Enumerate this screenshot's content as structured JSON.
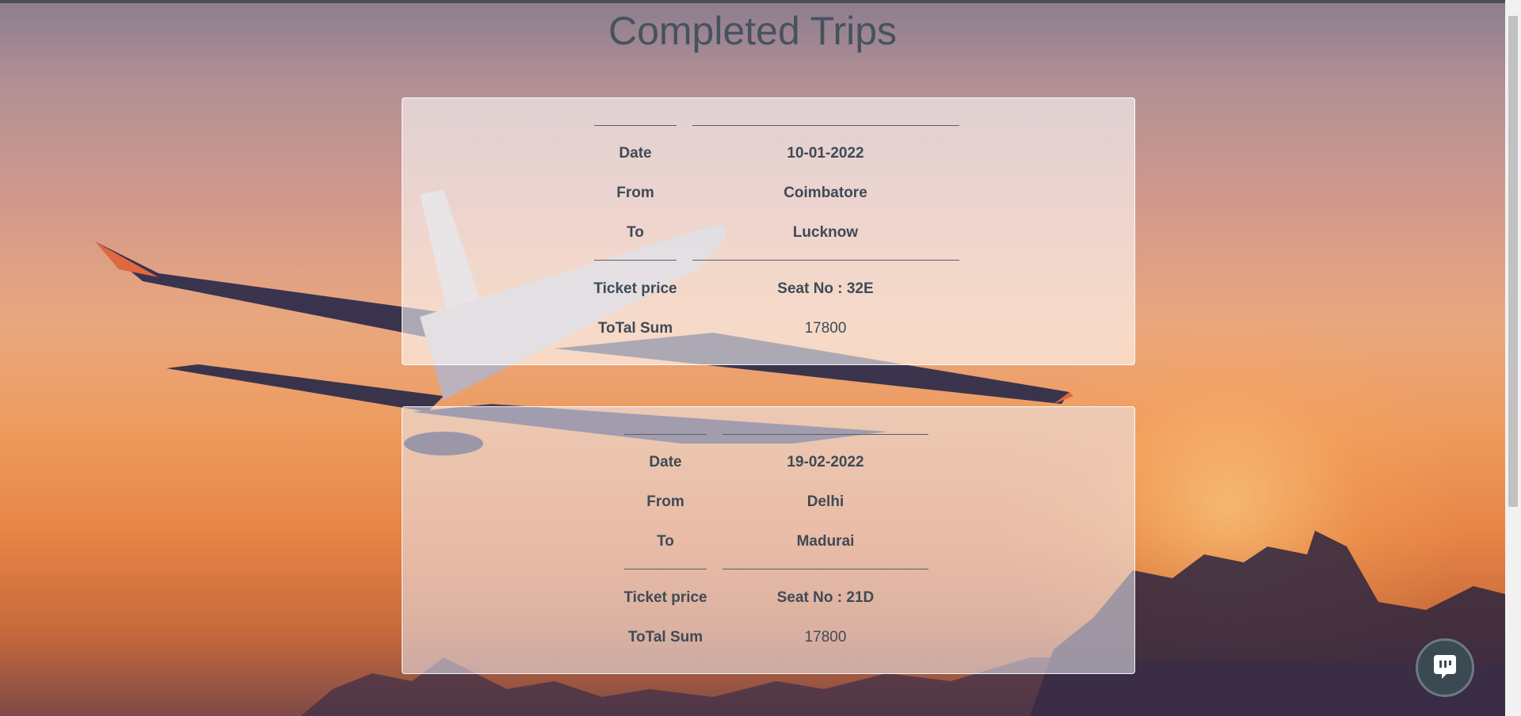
{
  "page": {
    "title": "Completed Trips"
  },
  "trips": [
    {
      "date_label": "Date",
      "date_value": "10-01-2022",
      "from_label": "From",
      "from_value": "Coimbatore",
      "to_label": "To",
      "to_value": "Lucknow",
      "price_label": "Ticket price",
      "seat_value": "Seat No : 32E",
      "total_label": "ToTal Sum",
      "total_value": "17800"
    },
    {
      "date_label": "Date",
      "date_value": "19-02-2022",
      "from_label": "From",
      "from_value": "Delhi",
      "to_label": "To",
      "to_value": "Madurai",
      "price_label": "Ticket price",
      "seat_value": "Seat No : 21D",
      "total_label": "ToTal Sum",
      "total_value": "17800"
    }
  ],
  "chat": {
    "icon": "chat-bubble-icon"
  },
  "colors": {
    "title": "#46525f",
    "text": "#3f4a56",
    "chat_bg": "#3b4a52"
  }
}
